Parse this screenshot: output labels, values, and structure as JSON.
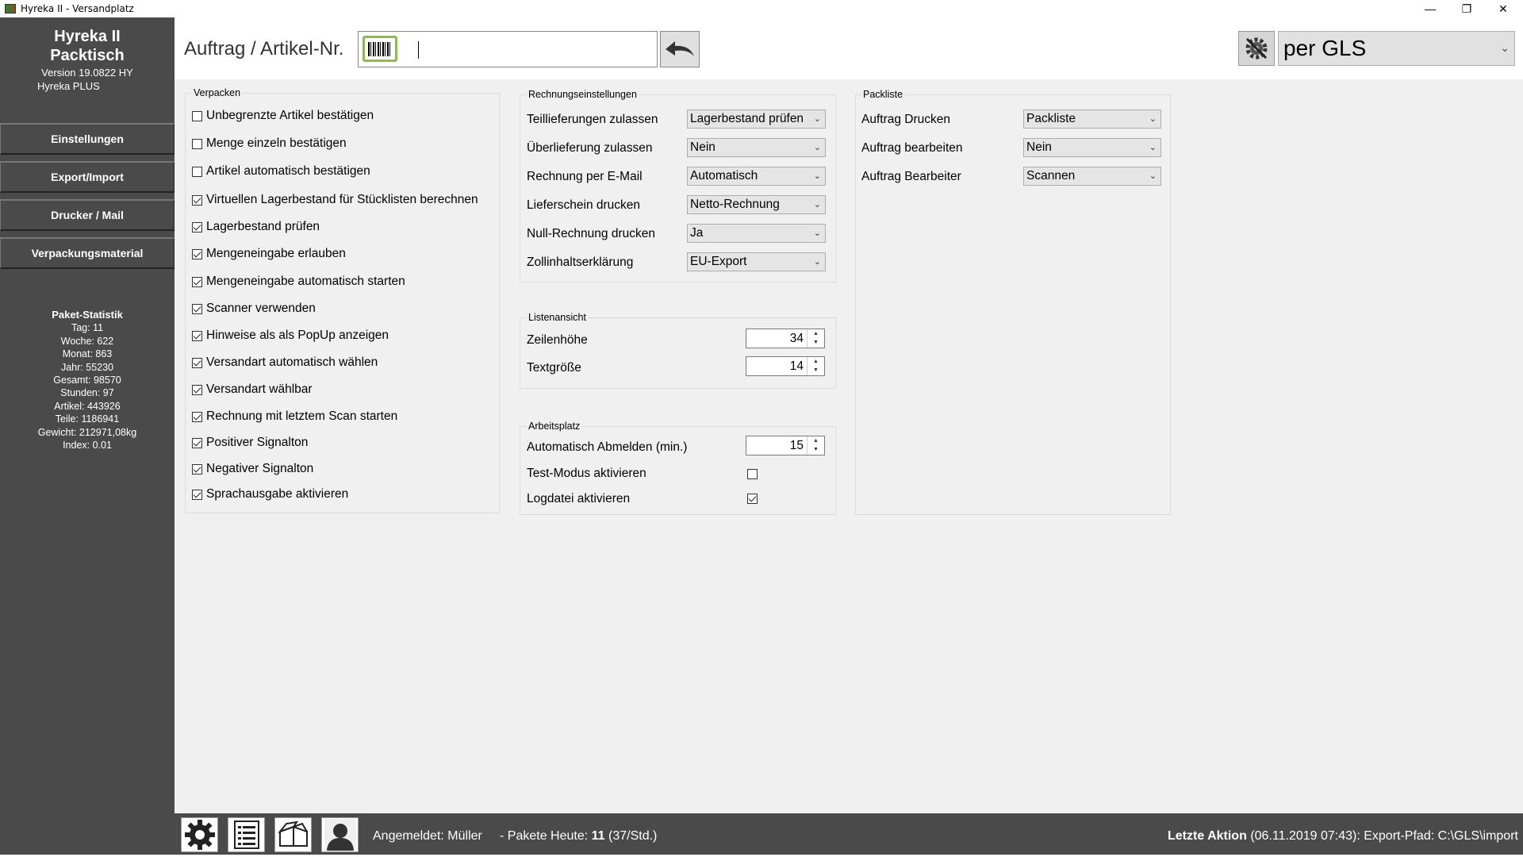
{
  "window": {
    "title": "Hyreka II - Versandplatz",
    "controls": {
      "minimize": "—",
      "maximize": "❐",
      "close": "✕"
    }
  },
  "sidebar": {
    "brand_line1": "Hyreka II",
    "brand_line2": "Packtisch",
    "version": "Version 19.0822 HY",
    "edition": "Hyreka PLUS",
    "nav": {
      "settings": "Einstellungen",
      "export_import": "Export/Import",
      "printer_mail": "Drucker / Mail",
      "packaging": "Verpackungsmaterial"
    },
    "stats": {
      "title": "Paket-Statistik",
      "day": "Tag: 11",
      "week": "Woche: 622",
      "month": "Monat: 863",
      "year": "Jahr: 55230",
      "total": "Gesamt: 98570",
      "hours": "Stunden: 97",
      "articles": "Artikel: 443926",
      "parts": "Teile: 1186941",
      "weight": "Gewicht: 212971,08kg",
      "index": "Index: 0.01"
    }
  },
  "header": {
    "label": "Auftrag / Artikel-Nr.",
    "scan_value": "",
    "carrier": "per GLS"
  },
  "verpacken": {
    "title": "Verpacken",
    "items": [
      {
        "label": "Unbegrenzte Artikel bestätigen",
        "checked": false
      },
      {
        "label": "Menge einzeln bestätigen",
        "checked": false
      },
      {
        "label": "Artikel automatisch bestätigen",
        "checked": false
      },
      {
        "label": "Virtuellen Lagerbestand für Stücklisten berechnen",
        "checked": true
      },
      {
        "label": "Lagerbestand prüfen",
        "checked": true
      },
      {
        "label": "Mengeneingabe erlauben",
        "checked": true
      },
      {
        "label": "Mengeneingabe automatisch starten",
        "checked": true
      },
      {
        "label": "Scanner verwenden",
        "checked": true
      },
      {
        "label": "Hinweise als als PopUp anzeigen",
        "checked": true
      },
      {
        "label": "Versandart automatisch wählen",
        "checked": true
      },
      {
        "label": "Versandart wählbar",
        "checked": true
      },
      {
        "label": "Rechnung mit letztem Scan starten",
        "checked": true
      },
      {
        "label": "Positiver Signalton",
        "checked": true
      },
      {
        "label": "Negativer Signalton",
        "checked": true
      },
      {
        "label": "Sprachausgabe aktivieren",
        "checked": true
      }
    ]
  },
  "rechnung": {
    "title": "Rechnungseinstellungen",
    "rows": [
      {
        "label": "Teillieferungen zulassen",
        "value": "Lagerbestand prüfen"
      },
      {
        "label": "Überlieferung zulassen",
        "value": "Nein"
      },
      {
        "label": "Rechnung per E-Mail",
        "value": "Automatisch"
      },
      {
        "label": "Lieferschein drucken",
        "value": "Netto-Rechnung"
      },
      {
        "label": "Null-Rechnung drucken",
        "value": "Ja"
      },
      {
        "label": "Zollinhaltserklärung",
        "value": "EU-Export"
      }
    ]
  },
  "listenansicht": {
    "title": "Listenansicht",
    "rows": [
      {
        "label": "Zeilenhöhe",
        "value": "34"
      },
      {
        "label": "Textgröße",
        "value": "14"
      }
    ]
  },
  "arbeitsplatz": {
    "title": "Arbeitsplatz",
    "logout_label": "Automatisch Abmelden (min.)",
    "logout_value": "15",
    "test_label": "Test-Modus aktivieren",
    "test_checked": false,
    "log_label": "Logdatei aktivieren",
    "log_checked": true
  },
  "packliste": {
    "title": "Packliste",
    "rows": [
      {
        "label": "Auftrag Drucken",
        "value": "Packliste"
      },
      {
        "label": "Auftrag bearbeiten",
        "value": "Nein"
      },
      {
        "label": "Auftrag Bearbeiter",
        "value": "Scannen"
      }
    ]
  },
  "footer": {
    "logged_in": "Angemeldet: Müller",
    "packages_prefix": "- Pakete Heute:",
    "packages_count": "11",
    "packages_rate": "(37/Std.)",
    "last_action_label": "Letzte Aktion",
    "last_action_text": "(06.11.2019 07:43): Export-Pfad: C:\\GLS\\import"
  },
  "icons": {
    "barcode": "barcode-icon",
    "back": "undo-arrow-icon",
    "tools": "gear-wrench-icon",
    "settings": "gear-icon",
    "list": "list-icon",
    "box": "box-icon",
    "user": "user-icon"
  },
  "colors": {
    "sidebar": "#4a4a4a",
    "accent_green": "#8cbf3f"
  }
}
